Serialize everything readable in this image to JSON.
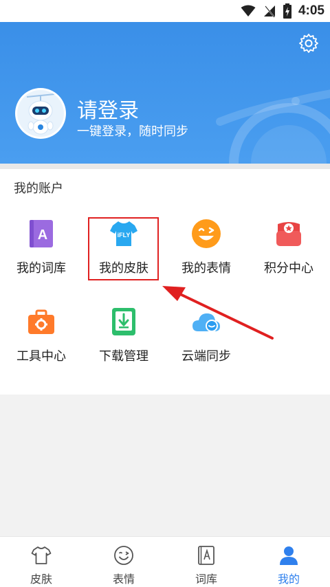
{
  "status_bar": {
    "time": "4:05"
  },
  "header": {
    "login_title": "请登录",
    "login_subtitle": "一键登录，随时同步",
    "accent_color": "#3a8fe8"
  },
  "account": {
    "section_title": "我的账户",
    "items": [
      {
        "label": "我的词库",
        "icon": "dictionary-icon",
        "color": "#9b6be0"
      },
      {
        "label": "我的皮肤",
        "icon": "skin-shirt-icon",
        "color": "#29a8f0"
      },
      {
        "label": "我的表情",
        "icon": "emoji-icon",
        "color": "#ff9b1a"
      },
      {
        "label": "积分中心",
        "icon": "points-shop-icon",
        "color": "#f05050"
      },
      {
        "label": "工具中心",
        "icon": "toolbox-icon",
        "color": "#ff7a2a"
      },
      {
        "label": "下载管理",
        "icon": "download-icon",
        "color": "#2dbe6c"
      },
      {
        "label": "云端同步",
        "icon": "cloud-sync-icon",
        "color": "#2a9cf0"
      }
    ]
  },
  "skin_badge_text": "iFLY",
  "dictionary_badge_text": "A",
  "bottom_nav": {
    "items": [
      {
        "label": "皮肤",
        "icon": "shirt-icon"
      },
      {
        "label": "表情",
        "icon": "smiley-icon"
      },
      {
        "label": "词库",
        "icon": "book-icon"
      },
      {
        "label": "我的",
        "icon": "user-icon",
        "active": true
      }
    ],
    "active_color": "#2f80ed"
  }
}
